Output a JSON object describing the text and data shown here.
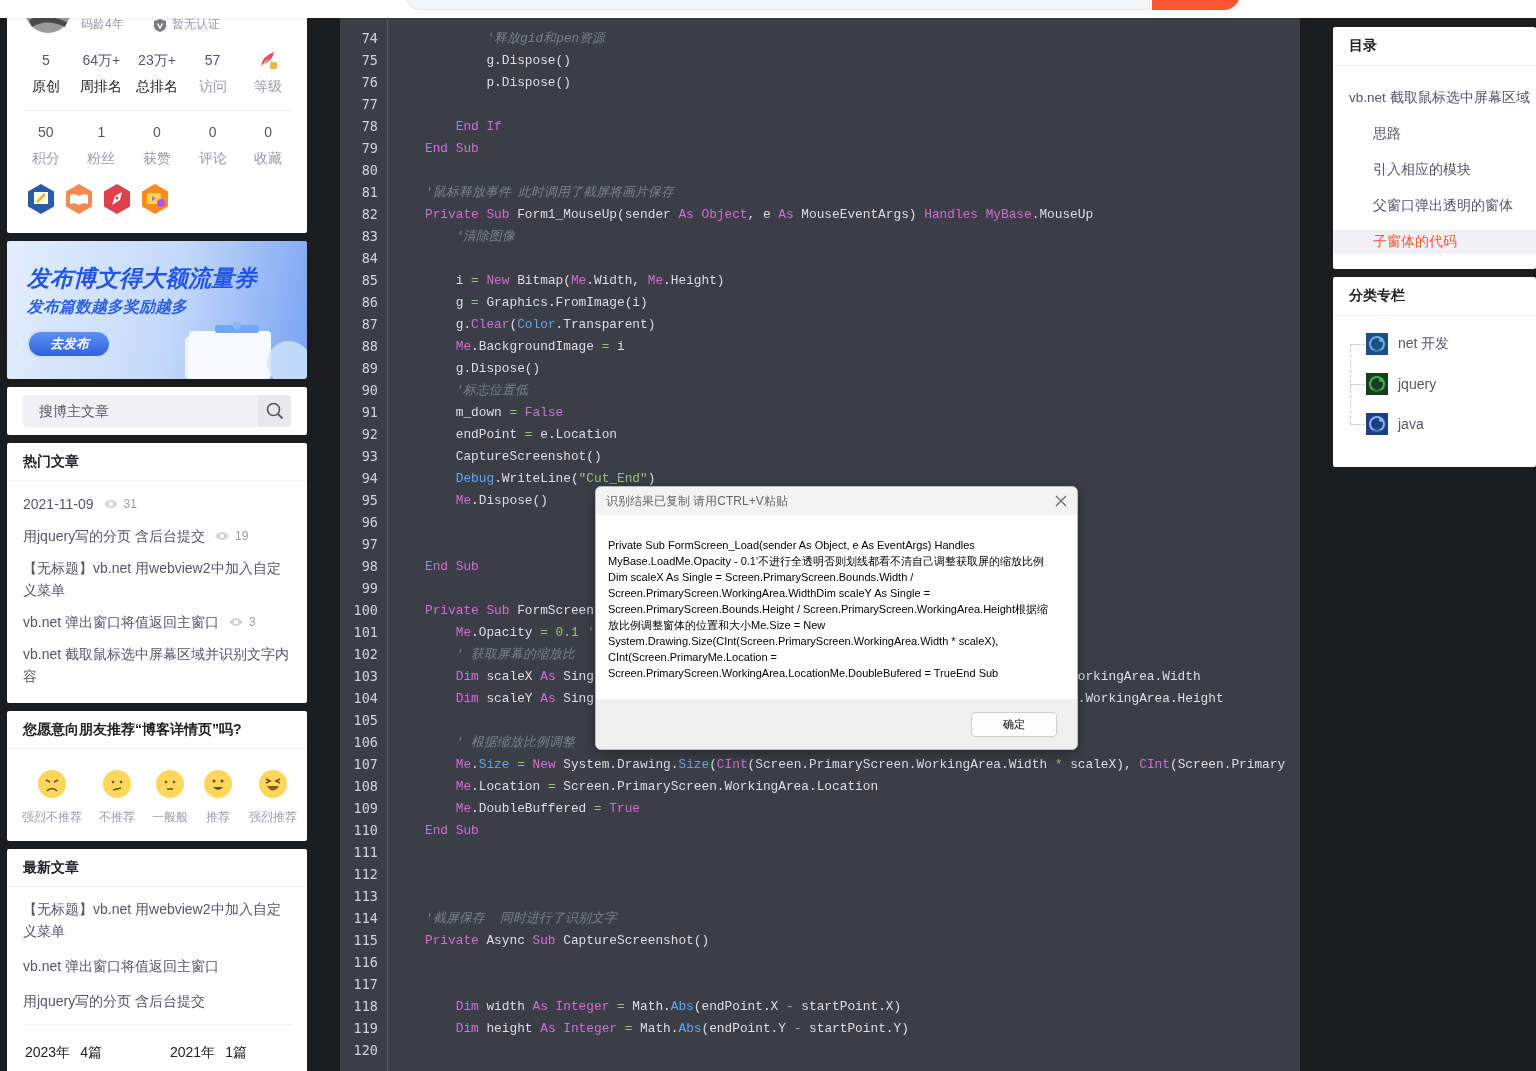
{
  "profile": {
    "coding_age": "码龄4年",
    "certification": "暂无认证",
    "stats": [
      {
        "kind": "number",
        "value": "5",
        "label": "原创",
        "muted": false
      },
      {
        "kind": "number",
        "value": "64万+",
        "label": "周排名",
        "muted": false
      },
      {
        "kind": "number",
        "value": "23万+",
        "label": "总排名",
        "muted": false
      },
      {
        "kind": "number",
        "value": "57",
        "label": "访问",
        "muted": true
      },
      {
        "kind": "level",
        "label": "等级",
        "muted": true
      }
    ],
    "counts": [
      {
        "value": "50",
        "label": "积分"
      },
      {
        "value": "1",
        "label": "粉丝"
      },
      {
        "value": "0",
        "label": "获赞"
      },
      {
        "value": "0",
        "label": "评论"
      },
      {
        "value": "0",
        "label": "收藏"
      }
    ],
    "badges": [
      {
        "kind": "write"
      },
      {
        "kind": "book"
      },
      {
        "kind": "pen"
      },
      {
        "kind": "video"
      }
    ]
  },
  "banner": {
    "title": "发布博文得大额流量券",
    "subtitle": "发布篇数越多奖励越多",
    "button": "去发布"
  },
  "blog_search": {
    "placeholder": "搜博主文章"
  },
  "hot_articles": {
    "title": "热门文章",
    "items": [
      {
        "title": "2021-11-09",
        "views": "31"
      },
      {
        "title": "用jquery写的分页 含后台提交",
        "views": "19"
      },
      {
        "title": "【无标题】vb.net 用webview2中加入自定义菜单"
      },
      {
        "title": "vb.net 弹出窗口将值返回主窗口",
        "views": "3"
      },
      {
        "title": "vb.net 截取鼠标选中屏幕区域并识别文字内容"
      }
    ]
  },
  "recommend": {
    "title": "您愿意向朋友推荐“博客详情页”吗?",
    "options": [
      {
        "kind": "angry",
        "label": "强烈不推荐"
      },
      {
        "kind": "unhappy",
        "label": "不推荐"
      },
      {
        "kind": "neutral",
        "label": "一般般"
      },
      {
        "kind": "smile",
        "label": "推荐"
      },
      {
        "kind": "laugh",
        "label": "强烈推荐"
      }
    ]
  },
  "latest_articles": {
    "title": "最新文章",
    "items": [
      {
        "title": "【无标题】vb.net 用webview2中加入自定义菜单"
      },
      {
        "title": "vb.net 弹出窗口将值返回主窗口"
      },
      {
        "title": "用jquery写的分页 含后台提交"
      }
    ],
    "archives": [
      {
        "year": "2023年",
        "count": "4篇"
      },
      {
        "year": "2021年",
        "count": "1篇"
      }
    ]
  },
  "code": {
    "lines": [
      {
        "number": "74",
        "tokens": [
          {
            "kind": "comment",
            "text": "        '释放gid和pen资源"
          }
        ]
      },
      {
        "number": "75",
        "tokens": [
          {
            "kind": "plain",
            "text": "        g.Dispose()"
          }
        ]
      },
      {
        "number": "76",
        "tokens": [
          {
            "kind": "plain",
            "text": "        p.Dispose()"
          }
        ]
      },
      {
        "number": "77"
      },
      {
        "number": "78",
        "tokens": [
          {
            "kind": "keyword",
            "text": "    End If"
          }
        ]
      },
      {
        "number": "79",
        "tokens": [
          {
            "kind": "keyword",
            "text": "End Sub"
          }
        ]
      },
      {
        "number": "80"
      },
      {
        "number": "81",
        "tokens": [
          {
            "kind": "comment",
            "text": "'鼠标释放事件 此时调用了截屏将画片保存"
          }
        ]
      },
      {
        "number": "82",
        "tokens": [
          {
            "kind": "keyword",
            "text": "Private Sub "
          },
          {
            "kind": "plain",
            "text": "Form1_MouseUp(sender "
          },
          {
            "kind": "keyword",
            "text": "As Object"
          },
          {
            "kind": "plain",
            "text": ", e "
          },
          {
            "kind": "keyword",
            "text": "As "
          },
          {
            "kind": "plain",
            "text": "MouseEventArgs) "
          },
          {
            "kind": "keyword",
            "text": "Handles MyBase"
          },
          {
            "kind": "plain",
            "text": ".MouseUp"
          }
        ]
      },
      {
        "number": "83",
        "tokens": [
          {
            "kind": "comment",
            "text": "    '清除图像"
          }
        ]
      },
      {
        "number": "84"
      },
      {
        "number": "85",
        "tokens": [
          {
            "kind": "plain",
            "text": "    i "
          },
          {
            "kind": "operator",
            "text": "="
          },
          {
            "kind": "keyword",
            "text": " New "
          },
          {
            "kind": "plain",
            "text": "Bitmap("
          },
          {
            "kind": "keyword",
            "text": "Me"
          },
          {
            "kind": "plain",
            "text": ".Width, "
          },
          {
            "kind": "keyword",
            "text": "Me"
          },
          {
            "kind": "plain",
            "text": ".Height)"
          }
        ]
      },
      {
        "number": "86",
        "tokens": [
          {
            "kind": "plain",
            "text": "    g "
          },
          {
            "kind": "operator",
            "text": "="
          },
          {
            "kind": "plain",
            "text": " Graphics.FromImage(i)"
          }
        ]
      },
      {
        "number": "87",
        "tokens": [
          {
            "kind": "plain",
            "text": "    g."
          },
          {
            "kind": "keyword",
            "text": "Clear"
          },
          {
            "kind": "plain",
            "text": "("
          },
          {
            "kind": "function",
            "text": "Color"
          },
          {
            "kind": "plain",
            "text": ".Transparent)"
          }
        ]
      },
      {
        "number": "88",
        "tokens": [
          {
            "kind": "keyword",
            "text": "    Me"
          },
          {
            "kind": "plain",
            "text": ".BackgroundImage "
          },
          {
            "kind": "operator",
            "text": "="
          },
          {
            "kind": "plain",
            "text": " i"
          }
        ]
      },
      {
        "number": "89",
        "tokens": [
          {
            "kind": "plain",
            "text": "    g.Dispose()"
          }
        ]
      },
      {
        "number": "90",
        "tokens": [
          {
            "kind": "comment",
            "text": "    '标志位置低"
          }
        ]
      },
      {
        "number": "91",
        "tokens": [
          {
            "kind": "plain",
            "text": "    m_down "
          },
          {
            "kind": "operator",
            "text": "="
          },
          {
            "kind": "keyword",
            "text": " False"
          }
        ]
      },
      {
        "number": "92",
        "tokens": [
          {
            "kind": "plain",
            "text": "    endPoint "
          },
          {
            "kind": "operator",
            "text": "="
          },
          {
            "kind": "plain",
            "text": " e.Location"
          }
        ]
      },
      {
        "number": "93",
        "tokens": [
          {
            "kind": "plain",
            "text": "    CaptureScreenshot()"
          }
        ]
      },
      {
        "number": "94",
        "tokens": [
          {
            "kind": "function",
            "text": "    Debug"
          },
          {
            "kind": "plain",
            "text": ".WriteLine("
          },
          {
            "kind": "string",
            "text": "\"Cut_End\""
          },
          {
            "kind": "plain",
            "text": ")"
          }
        ]
      },
      {
        "number": "95",
        "tokens": [
          {
            "kind": "keyword",
            "text": "    Me"
          },
          {
            "kind": "plain",
            "text": ".Dispose()"
          }
        ]
      },
      {
        "number": "96"
      },
      {
        "number": "97"
      },
      {
        "number": "98",
        "tokens": [
          {
            "kind": "keyword",
            "text": "End Sub"
          }
        ]
      },
      {
        "number": "99"
      },
      {
        "number": "100",
        "tokens": [
          {
            "kind": "keyword",
            "text": "Private Sub "
          },
          {
            "kind": "plain",
            "text": "FormScreen"
          }
        ]
      },
      {
        "number": "101",
        "tokens": [
          {
            "kind": "keyword",
            "text": "    Me"
          },
          {
            "kind": "plain",
            "text": ".Opacity "
          },
          {
            "kind": "operator",
            "text": "="
          },
          {
            "kind": "number",
            "text": " 0.1"
          },
          {
            "kind": "comment",
            "text": " '"
          }
        ]
      },
      {
        "number": "102",
        "tokens": [
          {
            "kind": "comment",
            "text": "    ' 获取屏幕的缩放比"
          }
        ]
      },
      {
        "number": "103",
        "tokens": [
          {
            "kind": "keyword",
            "text": "    Dim "
          },
          {
            "kind": "plain",
            "text": "scaleX "
          },
          {
            "kind": "keyword",
            "text": "As "
          },
          {
            "kind": "plain",
            "text": "Sing"
          }
        ],
        "tail": [
          {
            "kind": "plain",
            "text": "orkingArea.Width"
          }
        ]
      },
      {
        "number": "104",
        "tokens": [
          {
            "kind": "keyword",
            "text": "    Dim "
          },
          {
            "kind": "plain",
            "text": "scaleY "
          },
          {
            "kind": "keyword",
            "text": "As "
          },
          {
            "kind": "plain",
            "text": "Sing"
          }
        ],
        "tail": [
          {
            "kind": "plain",
            "text": ".WorkingArea.Height"
          }
        ]
      },
      {
        "number": "105"
      },
      {
        "number": "106",
        "tokens": [
          {
            "kind": "comment",
            "text": "    ' 根据缩放比例调整"
          }
        ]
      },
      {
        "number": "107",
        "tokens": [
          {
            "kind": "keyword",
            "text": "    Me"
          },
          {
            "kind": "plain",
            "text": "."
          },
          {
            "kind": "function",
            "text": "Size"
          },
          {
            "kind": "operator",
            "text": " = "
          },
          {
            "kind": "keyword",
            "text": "New "
          },
          {
            "kind": "plain",
            "text": "System.Drawing."
          },
          {
            "kind": "function",
            "text": "Size"
          },
          {
            "kind": "plain",
            "text": "("
          },
          {
            "kind": "keyword",
            "text": "CInt"
          },
          {
            "kind": "plain",
            "text": "(Screen.PrimaryScreen.WorkingArea.Width "
          },
          {
            "kind": "operator",
            "text": "*"
          },
          {
            "kind": "plain",
            "text": " scaleX), "
          },
          {
            "kind": "keyword",
            "text": "CInt"
          },
          {
            "kind": "plain",
            "text": "(Screen.Primary"
          }
        ]
      },
      {
        "number": "108",
        "tokens": [
          {
            "kind": "keyword",
            "text": "    Me"
          },
          {
            "kind": "plain",
            "text": ".Location "
          },
          {
            "kind": "operator",
            "text": "="
          },
          {
            "kind": "plain",
            "text": " Screen.PrimaryScreen.WorkingArea.Location"
          }
        ]
      },
      {
        "number": "109",
        "tokens": [
          {
            "kind": "keyword",
            "text": "    Me"
          },
          {
            "kind": "plain",
            "text": ".DoubleBuffered "
          },
          {
            "kind": "operator",
            "text": "="
          },
          {
            "kind": "keyword",
            "text": " True"
          }
        ]
      },
      {
        "number": "110",
        "tokens": [
          {
            "kind": "keyword",
            "text": "End Sub"
          }
        ]
      },
      {
        "number": "111"
      },
      {
        "number": "112"
      },
      {
        "number": "113"
      },
      {
        "number": "114",
        "tokens": [
          {
            "kind": "comment",
            "text": "'截屏保存  同时进行了识别文字"
          }
        ]
      },
      {
        "number": "115",
        "tokens": [
          {
            "kind": "keyword",
            "text": "Private "
          },
          {
            "kind": "plain",
            "text": "Async "
          },
          {
            "kind": "keyword",
            "text": "Sub "
          },
          {
            "kind": "plain",
            "text": "CaptureScreenshot()"
          }
        ]
      },
      {
        "number": "116"
      },
      {
        "number": "117"
      },
      {
        "number": "118",
        "tokens": [
          {
            "kind": "keyword",
            "text": "    Dim "
          },
          {
            "kind": "plain",
            "text": "width "
          },
          {
            "kind": "keyword",
            "text": "As Integer "
          },
          {
            "kind": "operator",
            "text": "="
          },
          {
            "kind": "plain",
            "text": " Math."
          },
          {
            "kind": "function",
            "text": "Abs"
          },
          {
            "kind": "plain",
            "text": "(endPoint.X "
          },
          {
            "kind": "operator",
            "text": "-"
          },
          {
            "kind": "plain",
            "text": " startPoint.X)"
          }
        ]
      },
      {
        "number": "119",
        "tokens": [
          {
            "kind": "keyword",
            "text": "    Dim "
          },
          {
            "kind": "plain",
            "text": "height "
          },
          {
            "kind": "keyword",
            "text": "As Integer "
          },
          {
            "kind": "operator",
            "text": "="
          },
          {
            "kind": "plain",
            "text": " Math."
          },
          {
            "kind": "function",
            "text": "Abs"
          },
          {
            "kind": "plain",
            "text": "(endPoint.Y "
          },
          {
            "kind": "operator",
            "text": "-"
          },
          {
            "kind": "plain",
            "text": " startPoint.Y)"
          }
        ]
      },
      {
        "number": "120"
      }
    ]
  },
  "dialog": {
    "title": "识别结果已复制 请用CTRL+V粘贴",
    "message": "Private Sub FormScreen_Load(sender As Object, e As EventArgs) Handles MyBase.LoadMe.Opacity - 0.1'不进行全透明否则划线都看不清自己调整获取屏的缩放比例Dim scaleX As Single = Screen.PrimaryScreen.Bounds.Width / Screen.PrimaryScreen.WorkingArea.WidthDim scaleY As Single = Screen.PrimaryScreen.Bounds.Height / Screen.PrimaryScreen.WorkingArea.Height根据缩放比例调整窗体的位置和大小Me.Size = New System.Drawing.Size(CInt(Screen.PrimaryScreen.WorkingArea.Width * scaleX), CInt(Screen.PrimaryMe.Location = Screen.PrimaryScreen.WorkingArea.LocationMe.DoubleBufered = TrueEnd Sub",
    "button": "确定"
  },
  "toc": {
    "title": "目录",
    "items": [
      {
        "label": "vb.net 截取鼠标选中屏幕区域",
        "selected": false,
        "children": [
          {
            "label": "思路",
            "selected": false
          },
          {
            "label": "引入相应的模块",
            "selected": false
          },
          {
            "label": "父窗口弹出透明的窗体",
            "selected": false
          },
          {
            "label": "子窗体的代码",
            "selected": true
          }
        ]
      }
    ]
  },
  "columns": {
    "title": "分类专栏",
    "items": [
      {
        "label": "net 开发"
      },
      {
        "label": "jquery"
      },
      {
        "label": "java"
      }
    ]
  }
}
